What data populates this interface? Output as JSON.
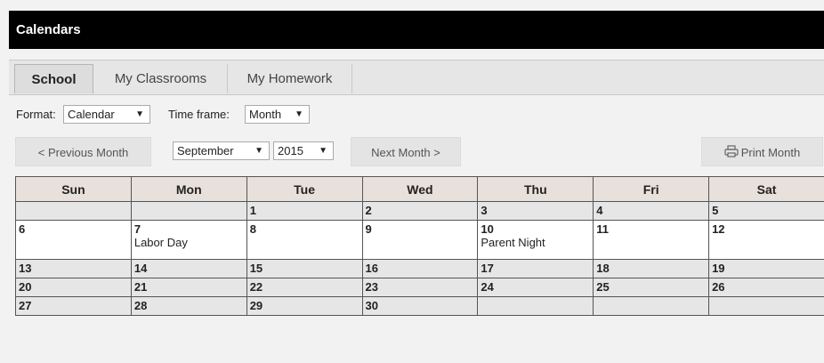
{
  "title": "Calendars",
  "tabs": [
    {
      "label": "School",
      "active": true
    },
    {
      "label": "My Classrooms",
      "active": false
    },
    {
      "label": "My Homework",
      "active": false
    }
  ],
  "format": {
    "label": "Format:",
    "value": "Calendar"
  },
  "timeframe": {
    "label": "Time frame:",
    "value": "Month"
  },
  "nav": {
    "prev_label": "< Previous Month",
    "month_value": "September",
    "year_value": "2015",
    "next_label": "Next Month >",
    "print_label": "Print Month"
  },
  "calendar": {
    "headers": [
      "Sun",
      "Mon",
      "Tue",
      "Wed",
      "Thu",
      "Fri",
      "Sat"
    ],
    "weeks": [
      [
        {
          "day": ""
        },
        {
          "day": ""
        },
        {
          "day": "1"
        },
        {
          "day": "2"
        },
        {
          "day": "3"
        },
        {
          "day": "4"
        },
        {
          "day": "5"
        }
      ],
      [
        {
          "day": "6"
        },
        {
          "day": "7",
          "event": "Labor Day"
        },
        {
          "day": "8"
        },
        {
          "day": "9"
        },
        {
          "day": "10",
          "event": "Parent Night"
        },
        {
          "day": "11"
        },
        {
          "day": "12"
        }
      ],
      [
        {
          "day": "13"
        },
        {
          "day": "14"
        },
        {
          "day": "15"
        },
        {
          "day": "16"
        },
        {
          "day": "17"
        },
        {
          "day": "18"
        },
        {
          "day": "19"
        }
      ],
      [
        {
          "day": "20",
          "today": true
        },
        {
          "day": "21"
        },
        {
          "day": "22"
        },
        {
          "day": "23"
        },
        {
          "day": "24"
        },
        {
          "day": "25"
        },
        {
          "day": "26"
        }
      ],
      [
        {
          "day": "27"
        },
        {
          "day": "28"
        },
        {
          "day": "29"
        },
        {
          "day": "30"
        },
        {
          "day": ""
        },
        {
          "day": ""
        },
        {
          "day": ""
        }
      ]
    ]
  },
  "colors": {
    "titlebar": "#000000",
    "today": "#ffffcc",
    "header": "#e8e0da"
  }
}
